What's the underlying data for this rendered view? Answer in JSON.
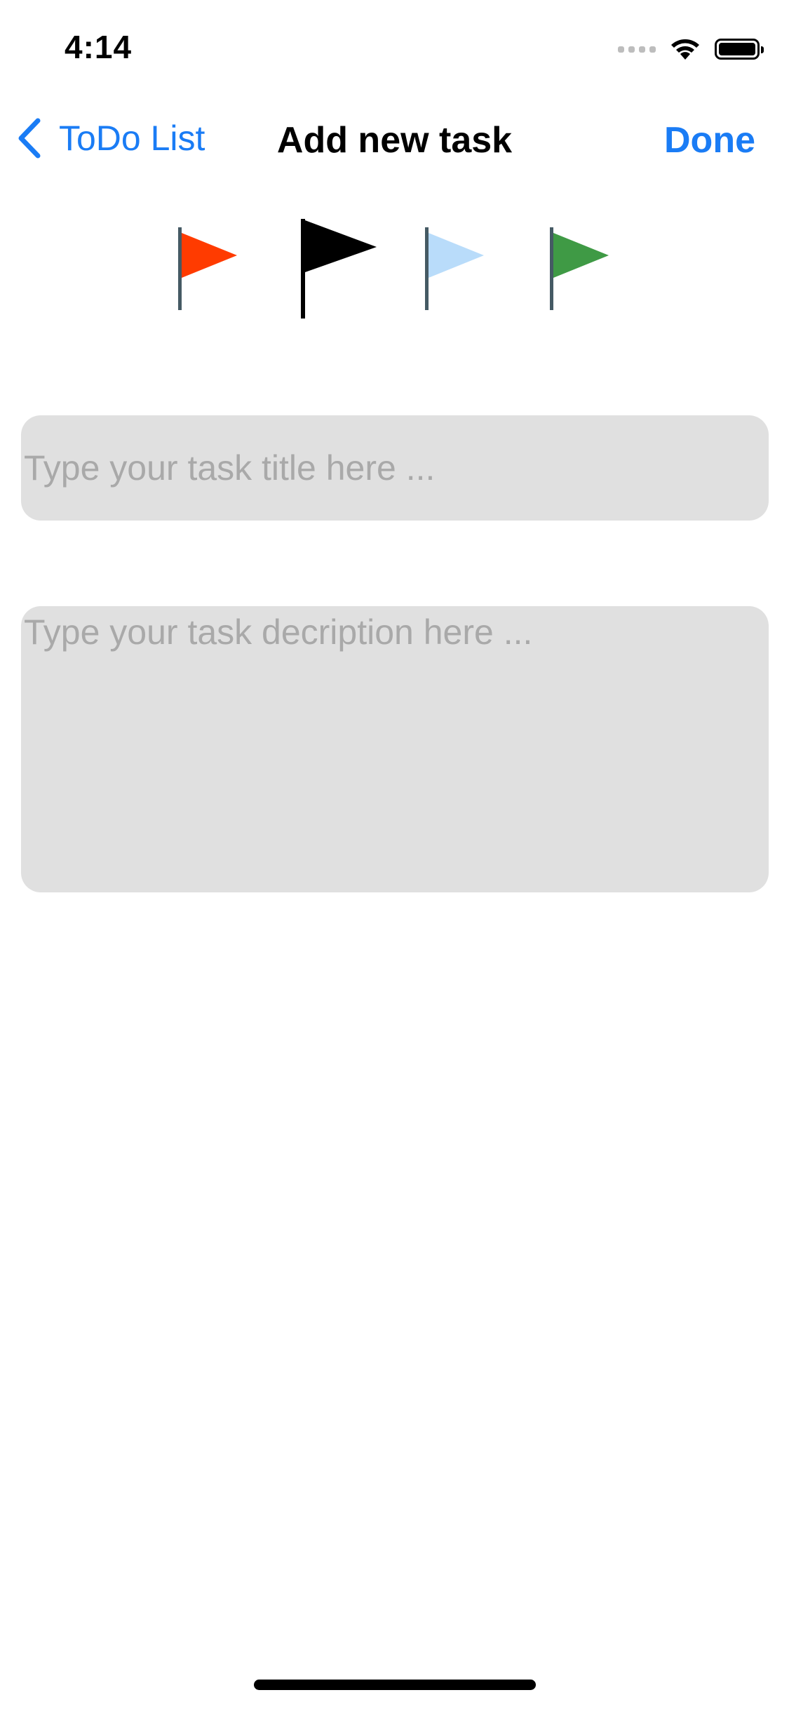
{
  "status_bar": {
    "time": "4:14",
    "icons": [
      "signal-dots-icon",
      "wifi-icon",
      "battery-icon"
    ]
  },
  "nav": {
    "back_label": "ToDo List",
    "back_icon": "chevron-left-icon",
    "title": "Add new task",
    "done_label": "Done",
    "accent_color": "#1a7cf5"
  },
  "flags": [
    {
      "name": "red-flag-icon",
      "color": "#ff3b00",
      "selected": false
    },
    {
      "name": "black-flag-icon",
      "color": "#000000",
      "selected": true
    },
    {
      "name": "light-blue-flag-icon",
      "color": "#b9dcfa",
      "selected": false
    },
    {
      "name": "green-flag-icon",
      "color": "#3f9a45",
      "selected": false
    }
  ],
  "form": {
    "title_placeholder": "Type your task title here ...",
    "title_value": "",
    "description_placeholder": "Type your task decription here ...",
    "description_value": ""
  }
}
